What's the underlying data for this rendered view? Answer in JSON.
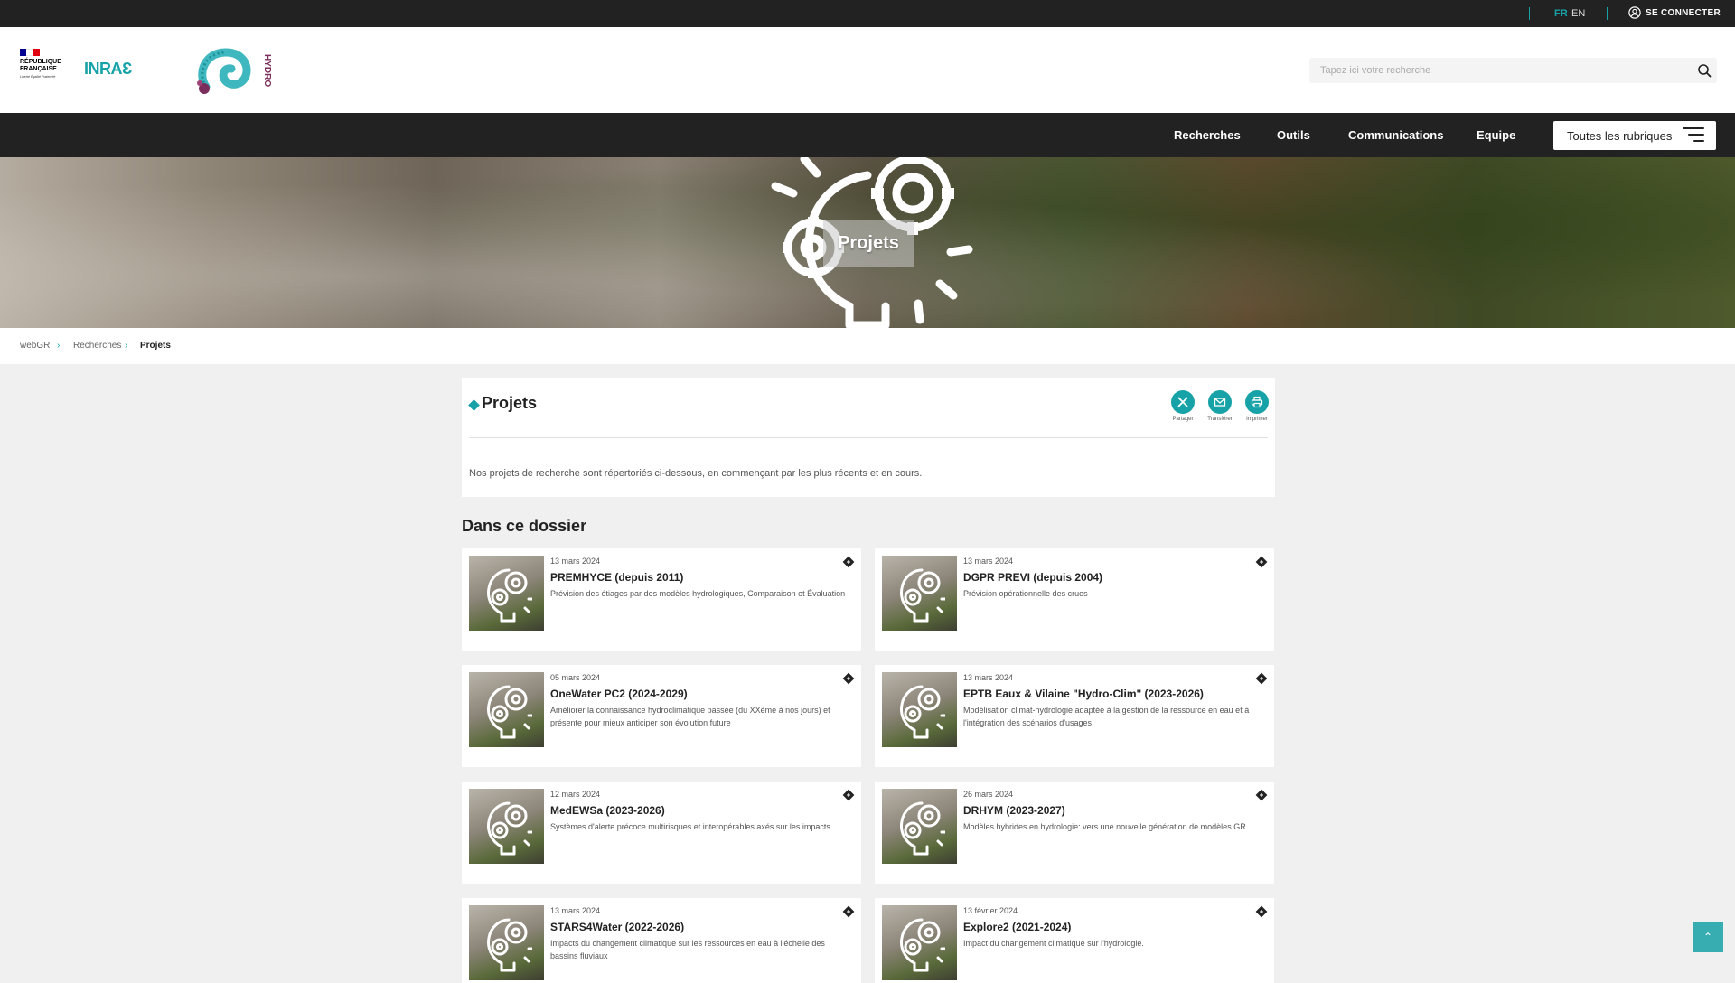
{
  "topbar": {
    "lang_fr": "FR",
    "lang_en": "EN",
    "login": "SE CONNECTER",
    "accent": "#17a2a8"
  },
  "header": {
    "republique_line1": "RÉPUBLIQUE",
    "republique_line2": "FRANÇAISE",
    "devise": "Liberté Égalité Fraternité",
    "inrae": "INRAƐ",
    "hydro_label": "HYDRO",
    "search_placeholder": "Tapez ici votre recherche"
  },
  "nav": {
    "items": [
      "Recherches",
      "Outils",
      "Communications",
      "Equipe"
    ],
    "all_label": "Toutes les rubriques"
  },
  "hero": {
    "title": "Projets"
  },
  "breadcrumb": [
    "webGR",
    "Recherches",
    "Projets"
  ],
  "intro": {
    "title": "Projets",
    "share_labels": [
      "Partager",
      "Transférer",
      "Imprimer"
    ],
    "description": "Nos projets de recherche sont répertoriés ci-dessous, en commençant par les plus récents et en cours."
  },
  "section_title": "Dans ce dossier",
  "projects": [
    {
      "date": "13 mars 2024",
      "title": "PREMHYCE (depuis 2011)",
      "summary": "Prévision des étiages par des modèles hydrologiques, Comparaison et Évaluation"
    },
    {
      "date": "13 mars 2024",
      "title": "DGPR PREVI (depuis 2004)",
      "summary": "Prévision opérationnelle des crues"
    },
    {
      "date": "05 mars 2024",
      "title": "OneWater PC2 (2024-2029)",
      "summary": "Améliorer la connaissance hydroclimatique passée (du XXème à nos jours) et présente pour mieux anticiper son évolution future"
    },
    {
      "date": "13 mars 2024",
      "title": "EPTB Eaux & Vilaine \"Hydro-Clim\" (2023-2026)",
      "summary": "Modélisation climat-hydrologie adaptée à la gestion de la ressource en eau et à l'intégration des scénarios d'usages"
    },
    {
      "date": "12 mars 2024",
      "title": "MedEWSa (2023-2026)",
      "summary": "Systèmes d'alerte précoce multirisques et interopérables axés sur les impacts"
    },
    {
      "date": "26 mars 2024",
      "title": "DRHYM (2023-2027)",
      "summary": "Modèles hybrides en hydrologie: vers une nouvelle génération de modèles GR"
    },
    {
      "date": "13 mars 2024",
      "title": "STARS4Water (2022-2026)",
      "summary": "Impacts du changement climatique sur les ressources en eau à l'échelle des bassins fluviaux"
    },
    {
      "date": "13 février 2024",
      "title": "Explore2 (2021-2024)",
      "summary": "Impact du changement climatique sur l'hydrologie."
    }
  ]
}
